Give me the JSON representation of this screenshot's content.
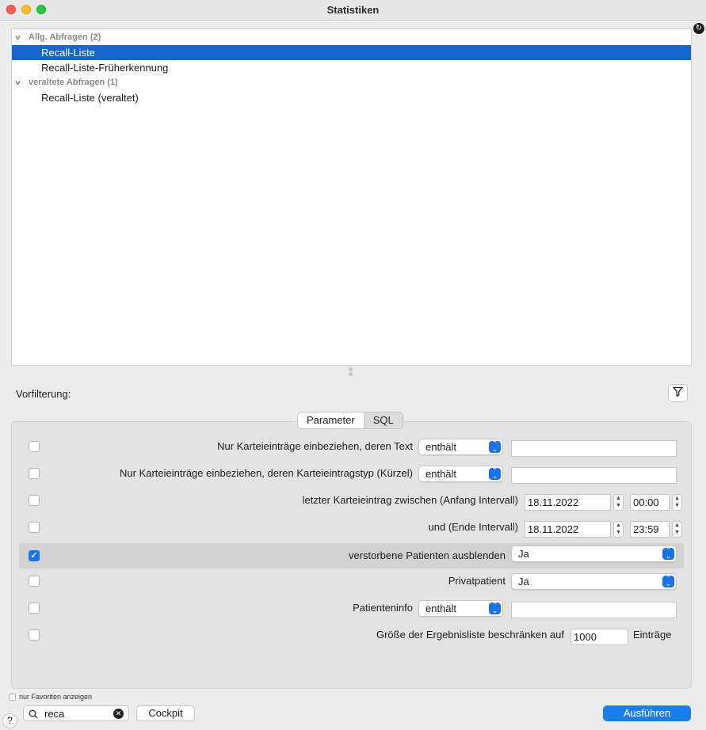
{
  "window": {
    "title": "Statistiken"
  },
  "tree": {
    "groups": [
      {
        "label": "Allg. Abfragen (2)",
        "items": [
          "Recall-Liste",
          "Recall-Liste-Früherkennung"
        ]
      },
      {
        "label": "veraltete Abfragen (1)",
        "items": [
          "Recall-Liste (veraltet)"
        ]
      }
    ],
    "selected": "Recall-Liste"
  },
  "vorfilterung": {
    "label": "Vorfilterung:"
  },
  "tabs": {
    "parameter": "Parameter",
    "sql": "SQL",
    "active": "Parameter"
  },
  "params": {
    "r1": {
      "checked": false,
      "label": "Nur Karteieinträge einbeziehen, deren Text",
      "op": "enthält",
      "value": ""
    },
    "r2": {
      "checked": false,
      "label": "Nur Karteieinträge einbeziehen, deren Karteieintragstyp (Kürzel)",
      "op": "enthält",
      "value": ""
    },
    "r3": {
      "checked": false,
      "label": "letzter Karteieintrag zwischen (Anfang Intervall)",
      "date": "18.11.2022",
      "time": "00:00"
    },
    "r4": {
      "checked": false,
      "label": "und (Ende Intervall)",
      "date": "18.11.2022",
      "time": "23:59"
    },
    "r5": {
      "checked": true,
      "label": "verstorbene Patienten ausblenden",
      "value": "Ja"
    },
    "r6": {
      "checked": false,
      "label": "Privatpatient",
      "value": "Ja"
    },
    "r7": {
      "checked": false,
      "label": "Patienteninfo",
      "op": "enthält",
      "value": ""
    },
    "r8": {
      "checked": false,
      "label": "Größe der Ergebnisliste beschränken auf",
      "value": "1000",
      "unit": "Einträge"
    }
  },
  "footer": {
    "favorites_label": "nur Favoriten anzeigen",
    "help": "?",
    "search_value": "reca",
    "cockpit": "Cockpit",
    "run": "Ausführen"
  },
  "colors": {
    "accent": "#1a7ef0",
    "selection": "#1666d2"
  }
}
